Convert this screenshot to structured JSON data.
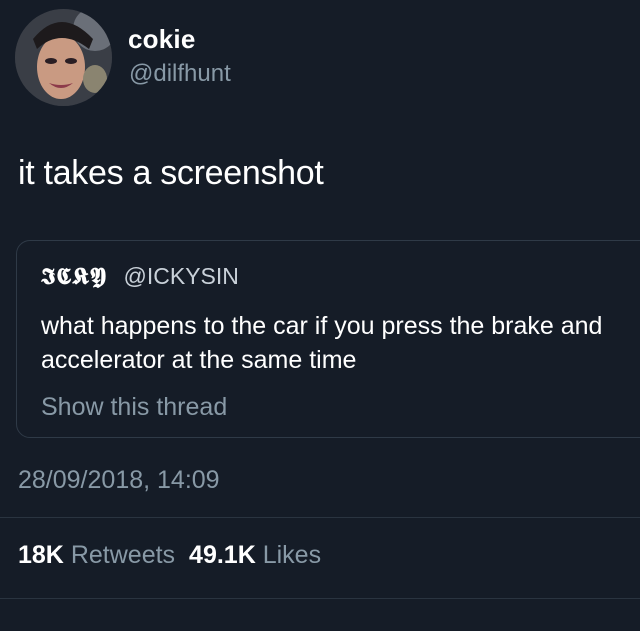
{
  "author": {
    "display_name": "cokie",
    "handle": "@dilfhunt"
  },
  "tweet": {
    "text": "it takes a screenshot"
  },
  "quoted_tweet": {
    "author_name": "𝕴𝕮𝕶𝖄",
    "handle": "@ICKYSIN",
    "text": "what happens to the car if you press the brake and accelerator at the same time",
    "show_thread": "Show this thread"
  },
  "timestamp": "28/09/2018, 14:09",
  "stats": {
    "retweets_count": "18K",
    "retweets_label": "Retweets",
    "likes_count": "49.1K",
    "likes_label": "Likes"
  },
  "colors": {
    "background": "#151c27",
    "secondary_text": "#8899a6",
    "border": "#2f3a47"
  }
}
